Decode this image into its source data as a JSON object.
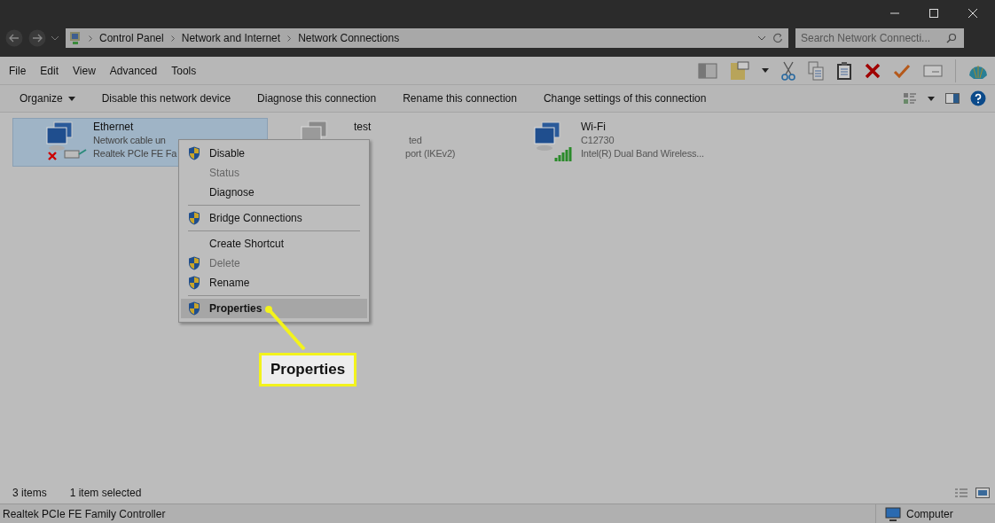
{
  "address_bar": {
    "breadcrumbs": [
      "Control Panel",
      "Network and Internet",
      "Network Connections"
    ]
  },
  "search": {
    "placeholder": "Search Network Connecti..."
  },
  "menu_bar": [
    "File",
    "Edit",
    "View",
    "Advanced",
    "Tools"
  ],
  "command_bar": {
    "organize": "Organize",
    "commands": [
      "Disable this network device",
      "Diagnose this connection",
      "Rename this connection",
      "Change settings of this connection"
    ]
  },
  "connections": [
    {
      "kind": "ethernet",
      "name": "Ethernet",
      "lines": [
        "Network cable un",
        "Realtek PCIe FE Fa"
      ],
      "selected": true
    },
    {
      "kind": "vpn",
      "name": "test",
      "lines": [
        "ted",
        "port (IKEv2)"
      ],
      "selected": false
    },
    {
      "kind": "wifi",
      "name": "Wi-Fi",
      "lines": [
        "C12730",
        "Intel(R) Dual Band Wireless..."
      ],
      "selected": false
    }
  ],
  "context_menu": [
    {
      "kind": "item",
      "label": "Disable",
      "shield": true,
      "disabled": false,
      "selected": false
    },
    {
      "kind": "item",
      "label": "Status",
      "shield": false,
      "disabled": true,
      "selected": false
    },
    {
      "kind": "item",
      "label": "Diagnose",
      "shield": false,
      "disabled": false,
      "selected": false
    },
    {
      "kind": "separator"
    },
    {
      "kind": "item",
      "label": "Bridge Connections",
      "shield": true,
      "disabled": false,
      "selected": false
    },
    {
      "kind": "separator"
    },
    {
      "kind": "item",
      "label": "Create Shortcut",
      "shield": false,
      "disabled": false,
      "selected": false
    },
    {
      "kind": "item",
      "label": "Delete",
      "shield": true,
      "disabled": true,
      "selected": false
    },
    {
      "kind": "item",
      "label": "Rename",
      "shield": true,
      "disabled": false,
      "selected": false
    },
    {
      "kind": "separator"
    },
    {
      "kind": "item",
      "label": "Properties",
      "shield": true,
      "disabled": false,
      "selected": true
    }
  ],
  "callout": {
    "label": "Properties"
  },
  "status_bar": {
    "item_count": "3 items",
    "selection": "1 item selected"
  },
  "details_bar": {
    "description": "Realtek PCIe FE Family Controller",
    "zone": "Computer"
  }
}
